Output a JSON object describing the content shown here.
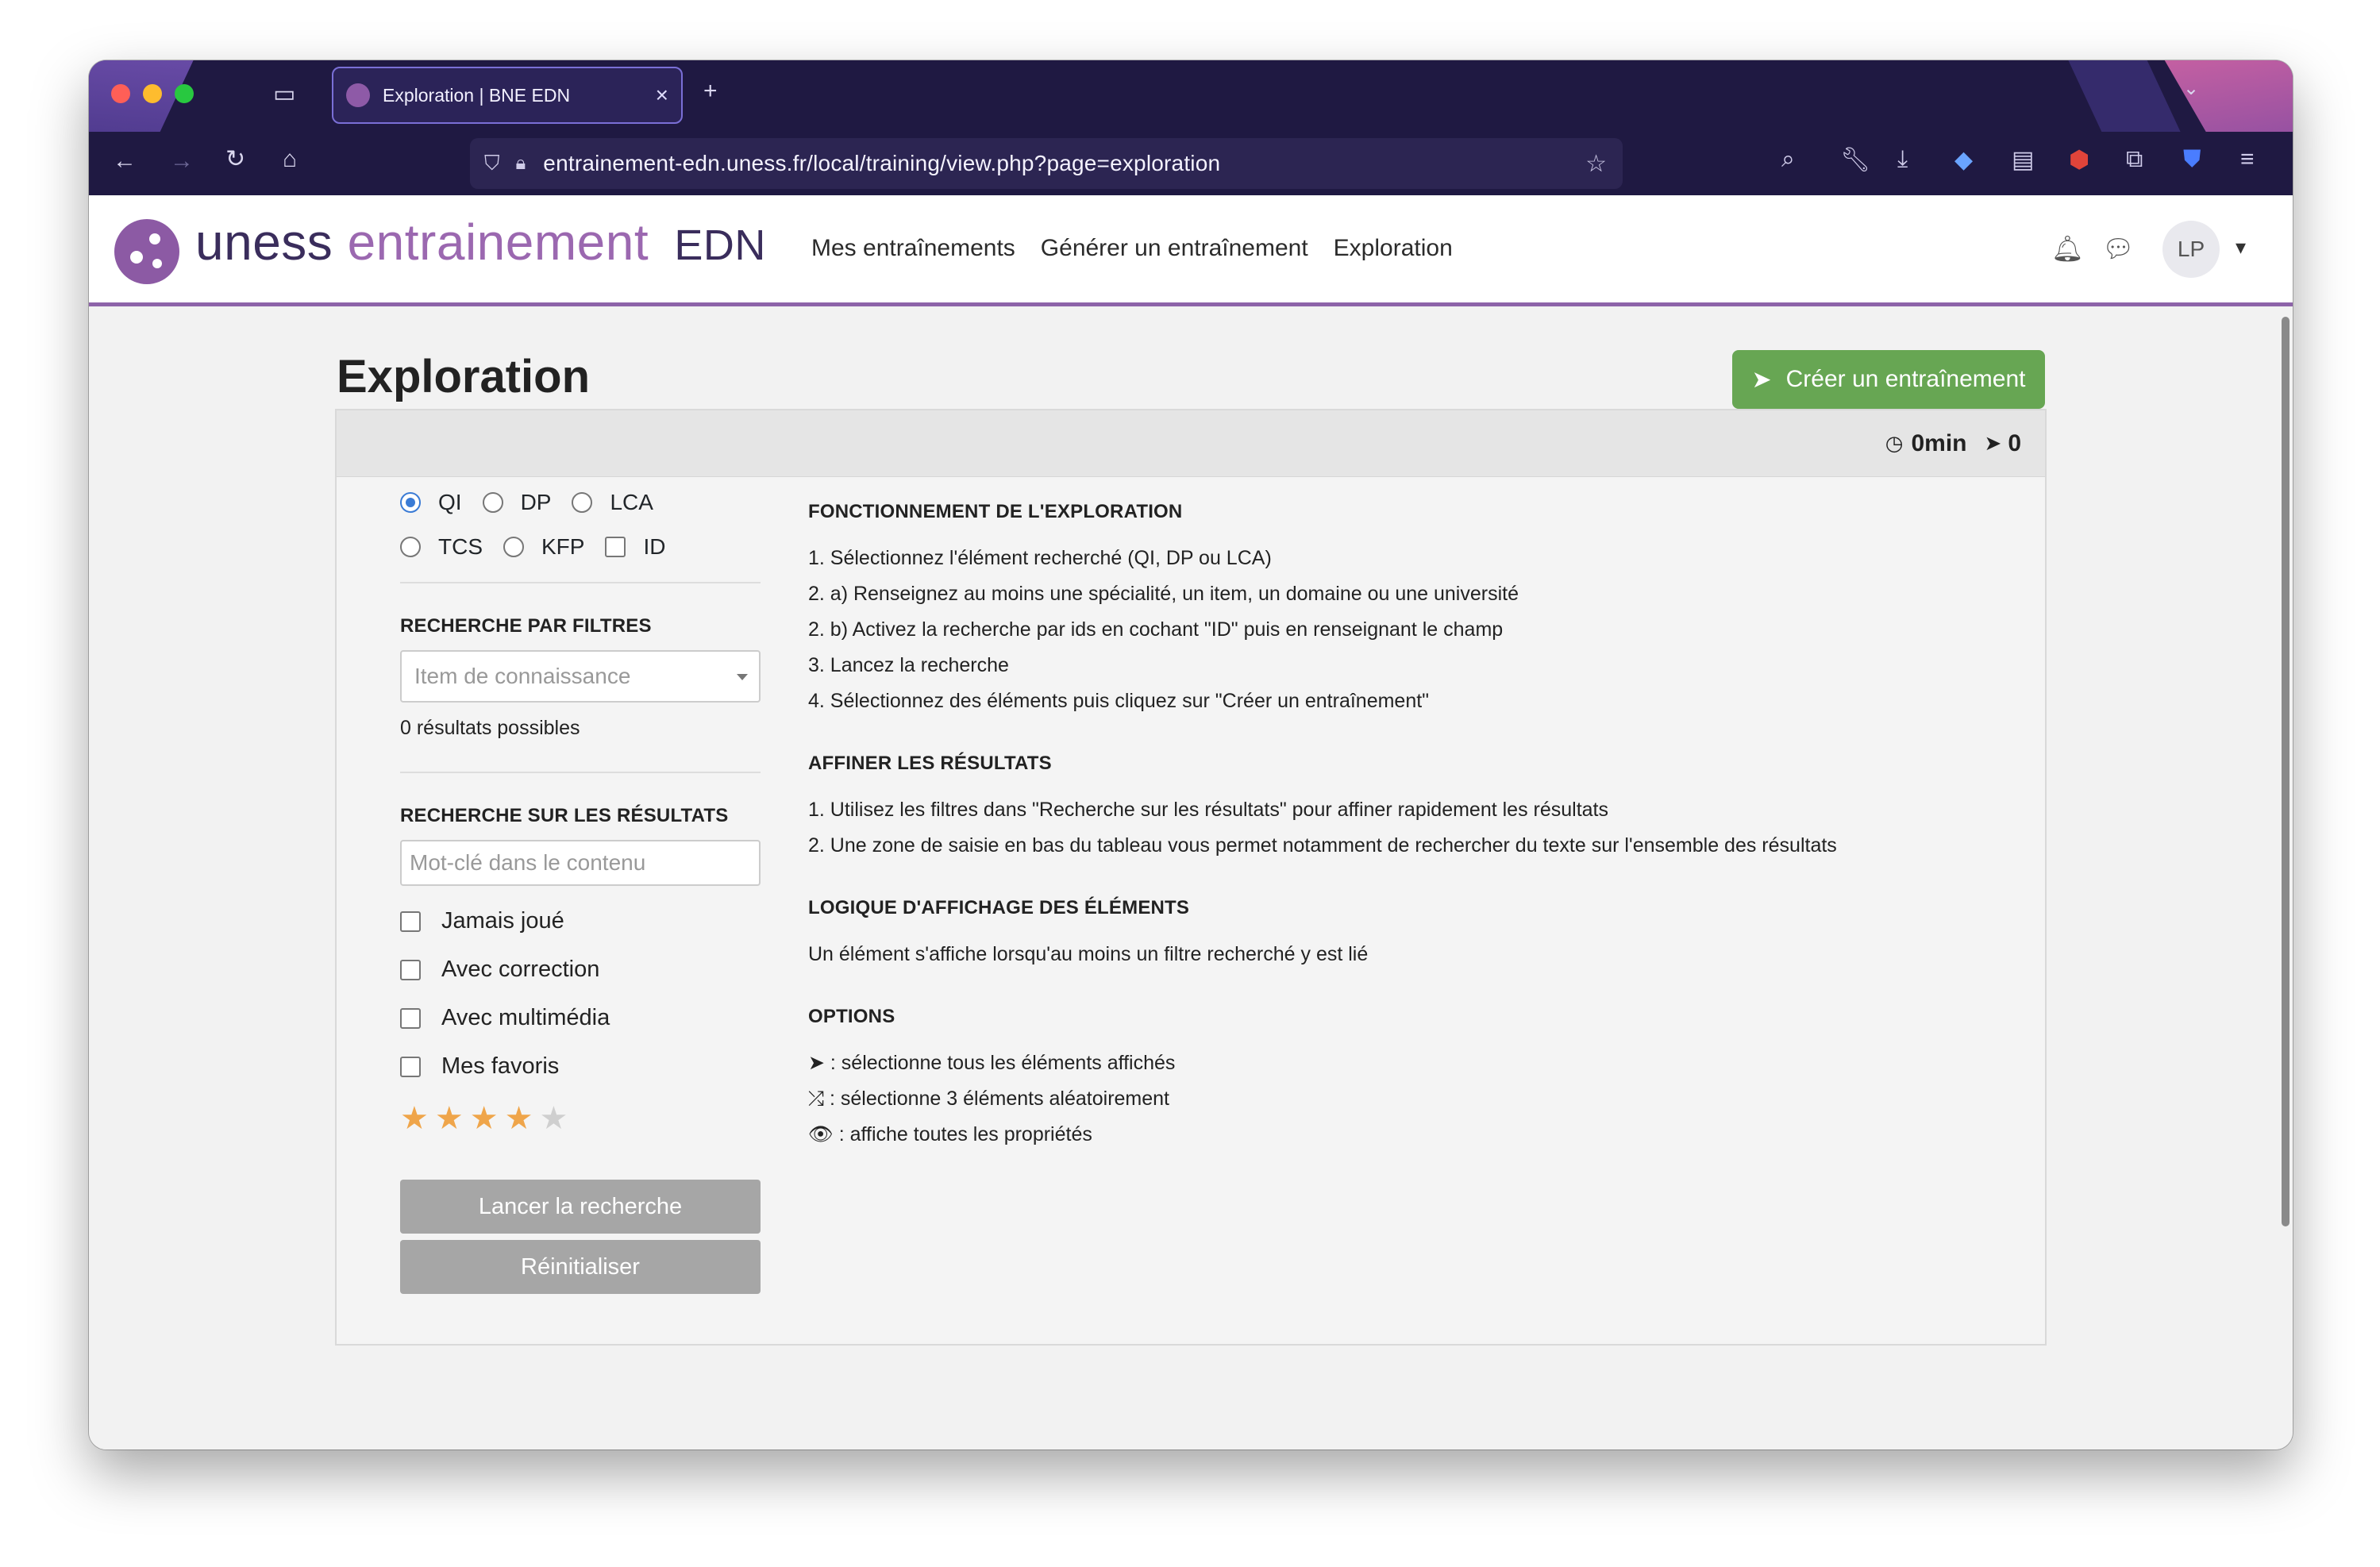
{
  "browser": {
    "tab_title": "Exploration | BNE EDN",
    "url": "entrainement-edn.uness.fr/local/training/view.php?page=exploration"
  },
  "header": {
    "brand_uness": "uness",
    "brand_entrainement": "entrainement",
    "brand_edn": "EDN",
    "nav": [
      "Mes entraînements",
      "Générer un entraînement",
      "Exploration"
    ],
    "avatar_initials": "LP"
  },
  "page": {
    "title": "Exploration",
    "create_button": "Créer un entraînement",
    "timer": "0min",
    "selected_count": "0"
  },
  "filters": {
    "types": [
      "QI",
      "DP",
      "LCA",
      "TCS",
      "KFP"
    ],
    "selected_type": "QI",
    "id_label": "ID",
    "filter_heading": "RECHERCHE PAR FILTRES",
    "item_placeholder": "Item de connaissance",
    "possible_results": "0 résultats possibles",
    "results_heading": "RECHERCHE SUR LES RÉSULTATS",
    "keyword_placeholder": "Mot-clé dans le contenu",
    "checkboxes": [
      "Jamais joué",
      "Avec correction",
      "Avec multimédia",
      "Mes favoris"
    ],
    "rating": 4,
    "rating_max": 5,
    "search_button": "Lancer la recherche",
    "reset_button": "Réinitialiser"
  },
  "info": {
    "how_heading": "FONCTIONNEMENT DE L'EXPLORATION",
    "how_steps": [
      "1. Sélectionnez l'élément recherché (QI, DP ou LCA)",
      "2. a) Renseignez au moins une spécialité, un item, un domaine ou une université",
      "2. b) Activez la recherche par ids en cochant \"ID\" puis en renseignant le champ",
      "3. Lancez la recherche",
      "4. Sélectionnez des éléments puis cliquez sur \"Créer un entraînement\""
    ],
    "refine_heading": "AFFINER LES RÉSULTATS",
    "refine_steps": [
      "1. Utilisez les filtres dans \"Recherche sur les résultats\" pour affiner rapidement les résultats",
      "2. Une zone de saisie en bas du tableau vous permet notamment de rechercher du texte sur l'ensemble des résultats"
    ],
    "logic_heading": "LOGIQUE D'AFFICHAGE DES ÉLÉMENTS",
    "logic_text": "Un élément s'affiche lorsqu'au moins un filtre recherché y est lié",
    "options_heading": "OPTIONS",
    "options": [
      ": sélectionne tous les éléments affichés",
      ": sélectionne 3 éléments aléatoirement",
      ": affiche toutes les propriétés"
    ]
  }
}
